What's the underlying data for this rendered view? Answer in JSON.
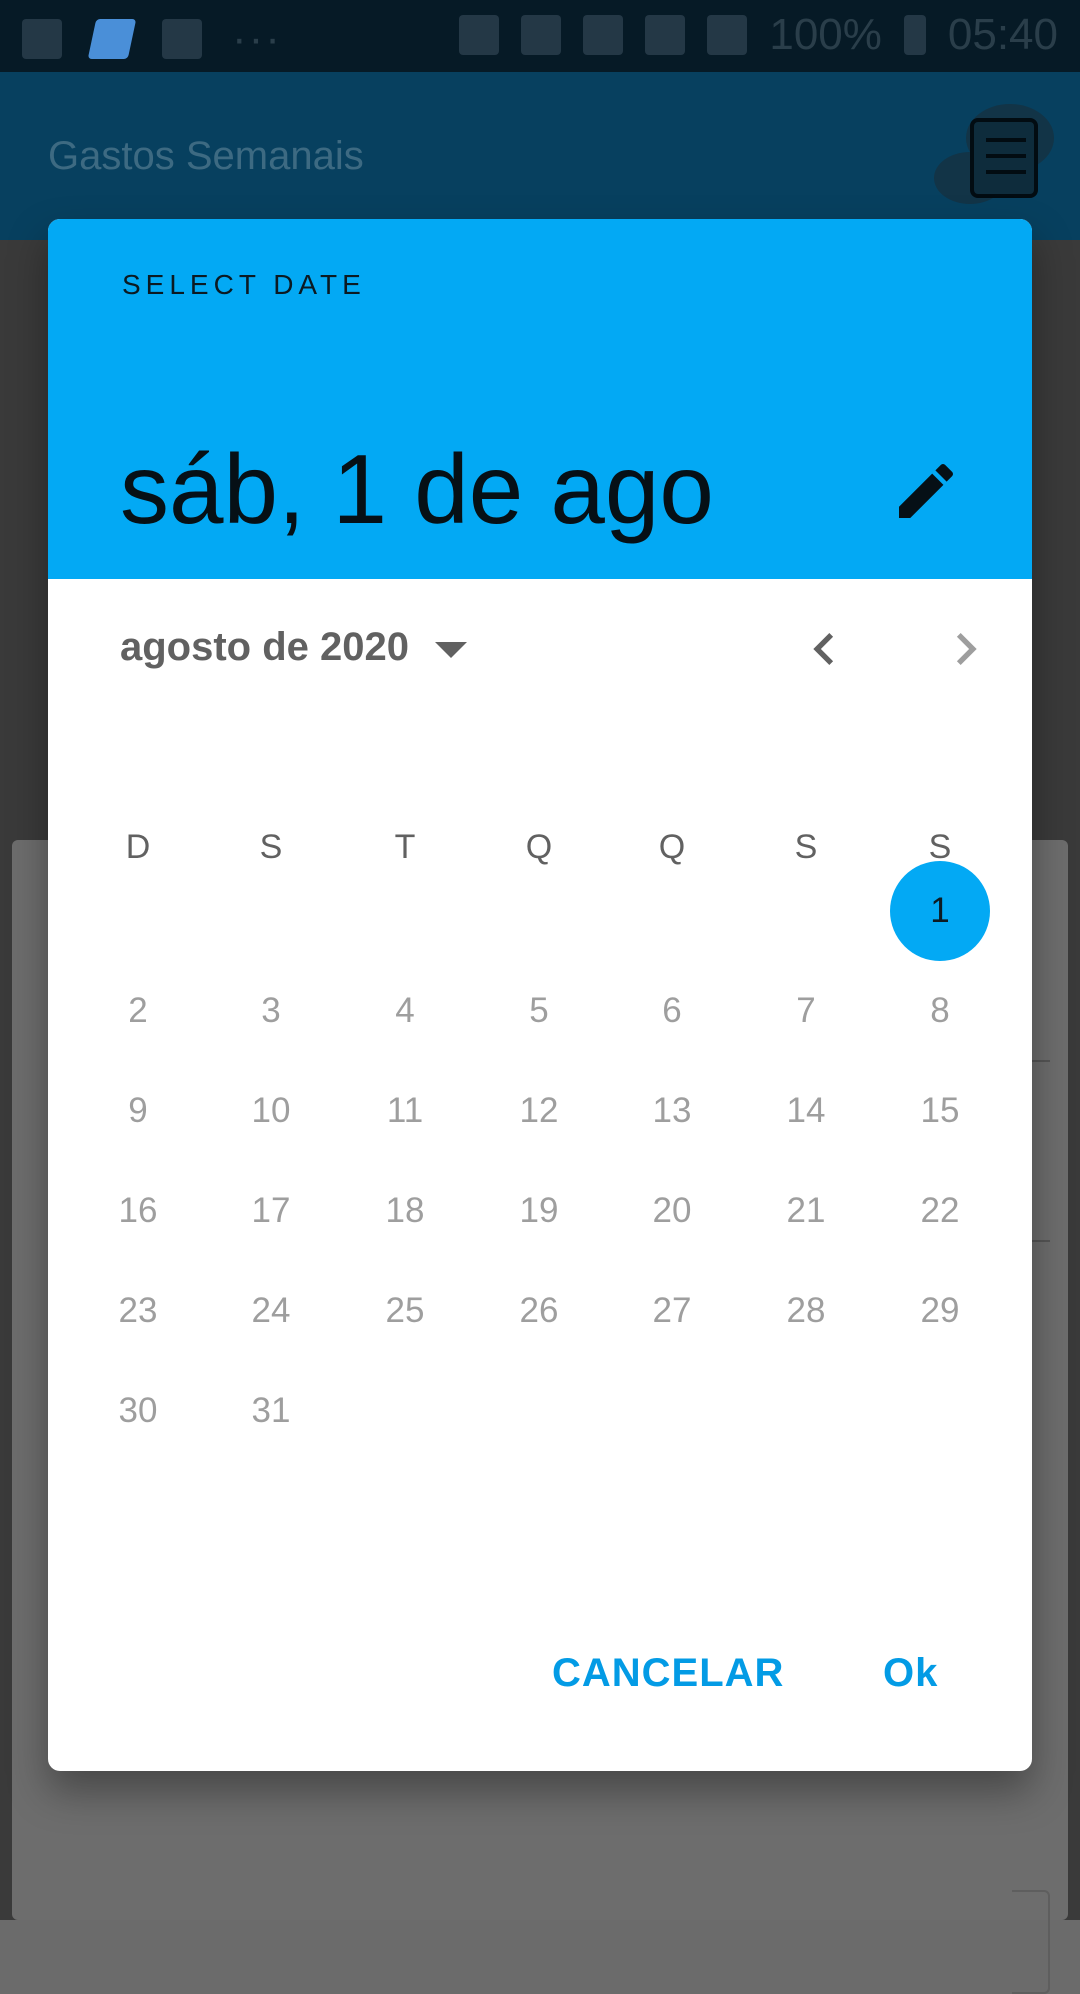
{
  "status_bar": {
    "battery": "100%",
    "time": "05:40",
    "more": "···"
  },
  "app_bar": {
    "title": "Gastos Semanais"
  },
  "dialog": {
    "label": "SELECT DATE",
    "selected_date": "sáb, 1 de ago",
    "month_year": "agosto de 2020",
    "weekdays": [
      "D",
      "S",
      "T",
      "Q",
      "Q",
      "S",
      "S"
    ],
    "selected_day": "1",
    "days": [
      "1",
      "2",
      "3",
      "4",
      "5",
      "6",
      "7",
      "8",
      "9",
      "10",
      "11",
      "12",
      "13",
      "14",
      "15",
      "16",
      "17",
      "18",
      "19",
      "20",
      "21",
      "22",
      "23",
      "24",
      "25",
      "26",
      "27",
      "28",
      "29",
      "30",
      "31"
    ],
    "first_weekday_index": 6,
    "cancel_label": "CANCELAR",
    "ok_label": "Ok"
  },
  "colors": {
    "header": "#03a9f4",
    "accent": "#039be5",
    "status_bar": "#061a26",
    "app_bar": "#07405f"
  }
}
